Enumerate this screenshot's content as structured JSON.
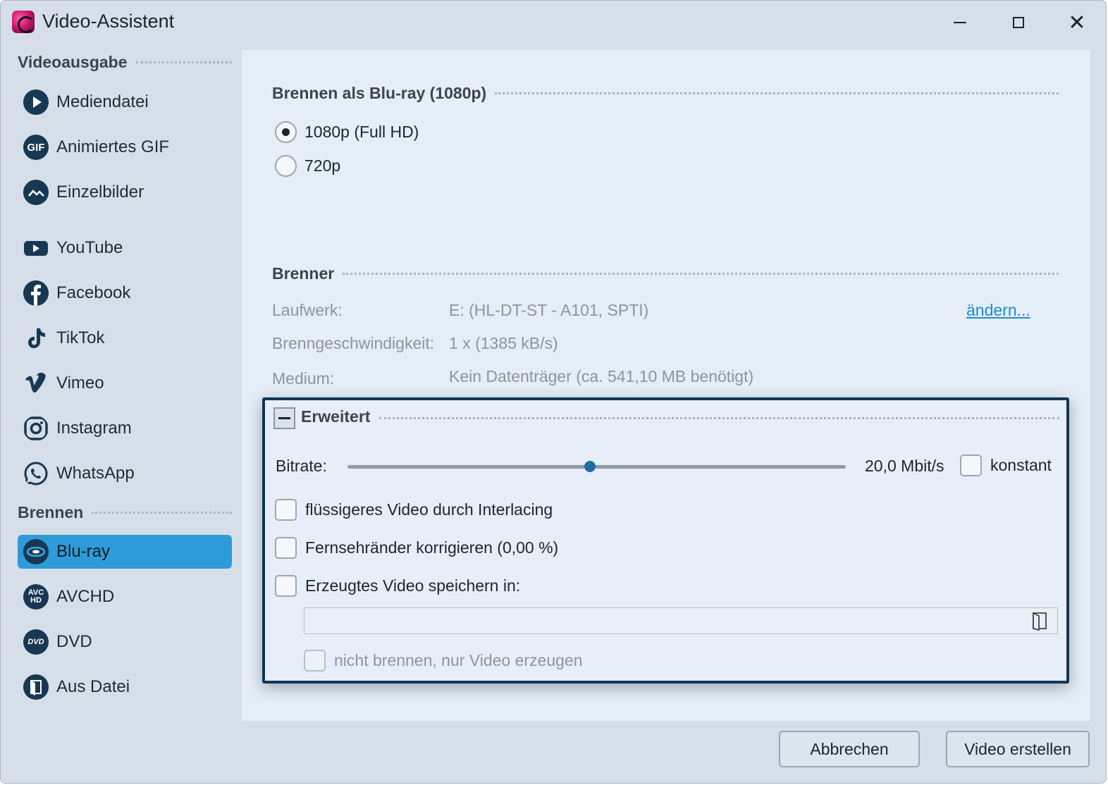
{
  "window": {
    "title": "Video-Assistent"
  },
  "sidebar": {
    "sections": [
      {
        "title": "Videoausgabe"
      },
      {
        "title": "Brennen"
      }
    ],
    "items": [
      {
        "label": "Mediendatei",
        "icon": "play-icon"
      },
      {
        "label": "Animiertes GIF",
        "icon": "gif-icon"
      },
      {
        "label": "Einzelbilder",
        "icon": "image-icon"
      },
      {
        "label": "YouTube",
        "icon": "youtube-icon"
      },
      {
        "label": "Facebook",
        "icon": "facebook-icon"
      },
      {
        "label": "TikTok",
        "icon": "tiktok-icon"
      },
      {
        "label": "Vimeo",
        "icon": "vimeo-icon"
      },
      {
        "label": "Instagram",
        "icon": "instagram-icon"
      },
      {
        "label": "WhatsApp",
        "icon": "whatsapp-icon"
      },
      {
        "label": "Blu-ray",
        "icon": "bluray-icon",
        "active": true
      },
      {
        "label": "AVCHD",
        "icon": "avchd-icon"
      },
      {
        "label": "DVD",
        "icon": "dvd-icon"
      },
      {
        "label": "Aus Datei",
        "icon": "file-icon"
      }
    ]
  },
  "burn_as": {
    "title": "Brennen als Blu-ray (1080p)",
    "options": [
      {
        "label": "1080p (Full HD)",
        "selected": true
      },
      {
        "label": "720p",
        "selected": false
      }
    ]
  },
  "burner": {
    "title": "Brenner",
    "drive_label": "Laufwerk:",
    "drive_value": "E: (HL-DT-ST - A101, SPTI)",
    "change_link": "ändern...",
    "speed_label": "Brenngeschwindigkeit:",
    "speed_value": "1 x (1385 kB/s)",
    "medium_label": "Medium:",
    "medium_value": "Kein Datenträger (ca. 541,10 MB benötigt)"
  },
  "advanced": {
    "title": "Erweitert",
    "bitrate_label": "Bitrate:",
    "bitrate_value": "20,0 Mbit/s",
    "bitrate_slider_fraction": 0.487,
    "constant_label": "konstant",
    "interlacing_label": "flüssigeres Video durch Interlacing",
    "tv_edges_label": "Fernsehränder korrigieren (0,00 %)",
    "save_video_label": "Erzeugtes Video speichern in:",
    "save_path_value": "",
    "no_burn_label": "nicht brennen, nur Video erzeugen"
  },
  "buttons": {
    "cancel": "Abbrechen",
    "create": "Video erstellen"
  },
  "colors": {
    "accent": "#2e9bd8",
    "link": "#1e8bd1",
    "focus_border": "#143654"
  }
}
